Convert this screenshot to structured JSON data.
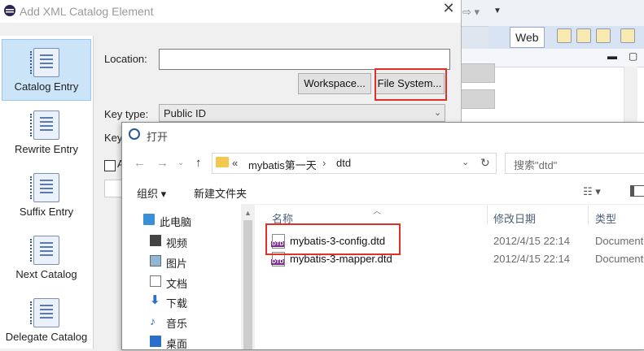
{
  "catalog_dialog": {
    "title": "Add XML Catalog Element",
    "nav": [
      {
        "label": "Catalog Entry",
        "icon": "catalog-entry-icon",
        "selected": true
      },
      {
        "label": "Rewrite Entry",
        "icon": "rewrite-entry-icon"
      },
      {
        "label": "Suffix Entry",
        "icon": "suffix-entry-icon"
      },
      {
        "label": "Next Catalog",
        "icon": "next-catalog-icon"
      },
      {
        "label": "Delegate Catalog",
        "icon": "delegate-catalog-icon"
      }
    ],
    "location_label": "Location:",
    "location_value": "",
    "workspace_button": "Workspace...",
    "file_system_button": "File System...",
    "key_type_label": "Key type:",
    "key_type_value": "Public ID",
    "key_label": "Key",
    "checkbox_label": "A"
  },
  "background": {
    "web_tab": "Web"
  },
  "open_dialog": {
    "title": "打开",
    "address": {
      "chevron": "«",
      "crumbs": [
        "mybatis第一天",
        "dtd"
      ]
    },
    "search_placeholder": "搜索\"dtd\"",
    "organize": "组织 ▾",
    "new_folder": "新建文件夹",
    "tree": [
      {
        "label": "此电脑",
        "icon": "computer-icon"
      },
      {
        "label": "视频",
        "icon": "video-icon"
      },
      {
        "label": "图片",
        "icon": "pictures-icon"
      },
      {
        "label": "文档",
        "icon": "documents-icon"
      },
      {
        "label": "下载",
        "icon": "download-icon"
      },
      {
        "label": "音乐",
        "icon": "music-icon"
      },
      {
        "label": "桌面",
        "icon": "desktop-icon"
      }
    ],
    "columns": {
      "name": "名称",
      "date": "修改日期",
      "type": "类型"
    },
    "files": [
      {
        "name": "mybatis-3-config.dtd",
        "date": "2012/4/15 22:14",
        "type": "Document"
      },
      {
        "name": "mybatis-3-mapper.dtd",
        "date": "2012/4/15 22:14",
        "type": "Document"
      }
    ],
    "colors": {
      "highlight": "#e0302a",
      "header_text": "#4c607a"
    }
  }
}
